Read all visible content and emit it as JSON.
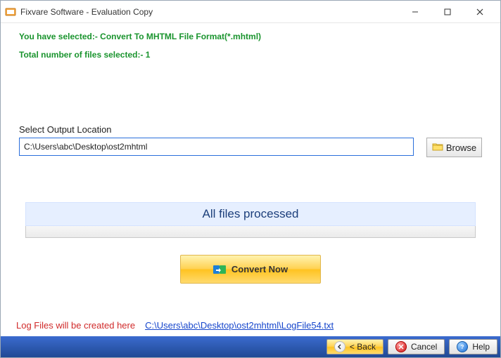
{
  "titlebar": {
    "title": "Fixvare Software - Evaluation Copy"
  },
  "info": {
    "selected_format": "You have selected:- Convert To MHTML File Format(*.mhtml)",
    "file_count": "Total number of files selected:- 1"
  },
  "output": {
    "label": "Select Output Location",
    "path": "C:\\Users\\abc\\Desktop\\ost2mhtml",
    "browse_label": "Browse"
  },
  "status": {
    "message": "All files processed"
  },
  "actions": {
    "convert_label": "Convert Now"
  },
  "log": {
    "label": "Log Files will be created here",
    "path": "C:\\Users\\abc\\Desktop\\ost2mhtml\\LogFile54.txt"
  },
  "footer": {
    "back": "< Back",
    "cancel": "Cancel",
    "help": "Help"
  }
}
